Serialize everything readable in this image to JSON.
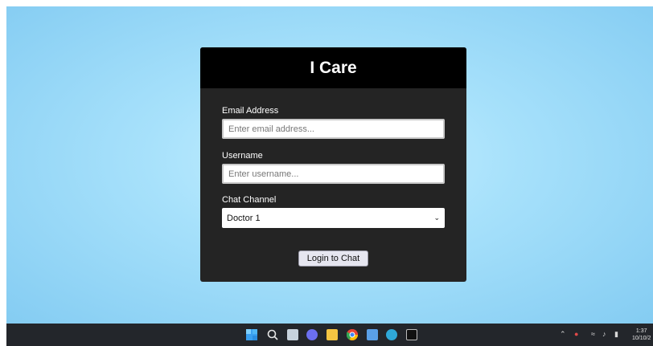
{
  "app": {
    "title": "I Care"
  },
  "form": {
    "email_label": "Email Address",
    "email_placeholder": "Enter email address...",
    "username_label": "Username",
    "username_placeholder": "Enter username...",
    "channel_label": "Chat Channel",
    "channel_selected": "Doctor 1",
    "login_button": "Login to Chat"
  },
  "taskbar": {
    "icons": [
      "windows-start-icon",
      "search-icon",
      "task-view-icon",
      "chat-icon",
      "file-explorer-icon",
      "chrome-icon",
      "store-icon",
      "edge-icon",
      "terminal-icon"
    ],
    "tray_icons": [
      "chevron-up-icon",
      "app-tray-icon",
      "wifi-icon",
      "volume-icon",
      "battery-icon"
    ],
    "clock_time": "1:37",
    "clock_date": "10/10/2"
  },
  "colors": {
    "card_bg": "#242424",
    "header_bg": "#000000",
    "desktop_bg": "#a7e1fb",
    "taskbar_bg": "#23262b"
  }
}
